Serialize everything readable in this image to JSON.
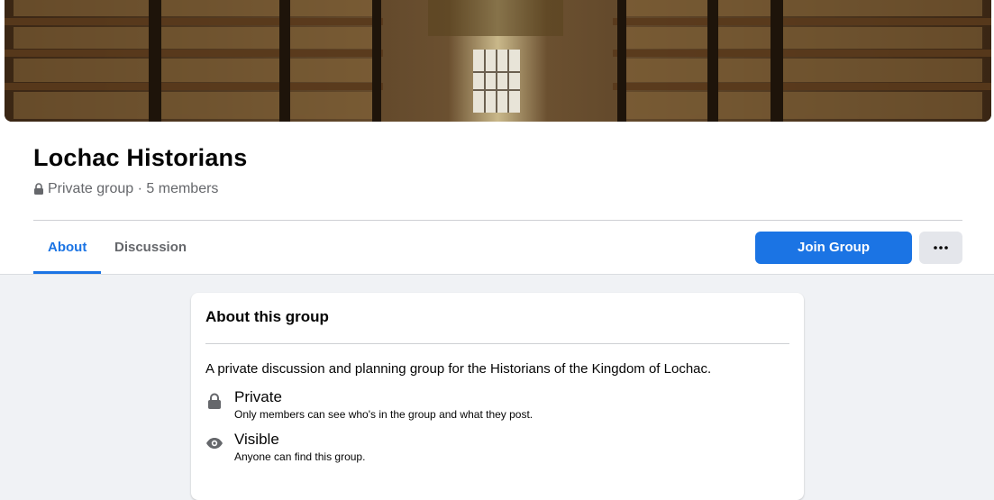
{
  "group": {
    "name": "Lochac Historians",
    "privacy_label": "Private group",
    "separator": " · ",
    "members": "5 members"
  },
  "tabs": [
    {
      "label": "About",
      "active": true
    },
    {
      "label": "Discussion",
      "active": false
    }
  ],
  "actions": {
    "join_label": "Join Group",
    "more_icon": "ellipsis-icon"
  },
  "about_card": {
    "title": "About this group",
    "description": "A private discussion and planning group for the Historians of the Kingdom of Lochac.",
    "items": [
      {
        "icon": "lock-icon",
        "label": "Private",
        "detail": "Only members can see who's in the group and what they post."
      },
      {
        "icon": "eye-icon",
        "label": "Visible",
        "detail": "Anyone can find this group."
      }
    ]
  },
  "colors": {
    "accent": "#1b74e4",
    "page_background": "#f0f2f5",
    "secondary_text": "#65676b"
  }
}
